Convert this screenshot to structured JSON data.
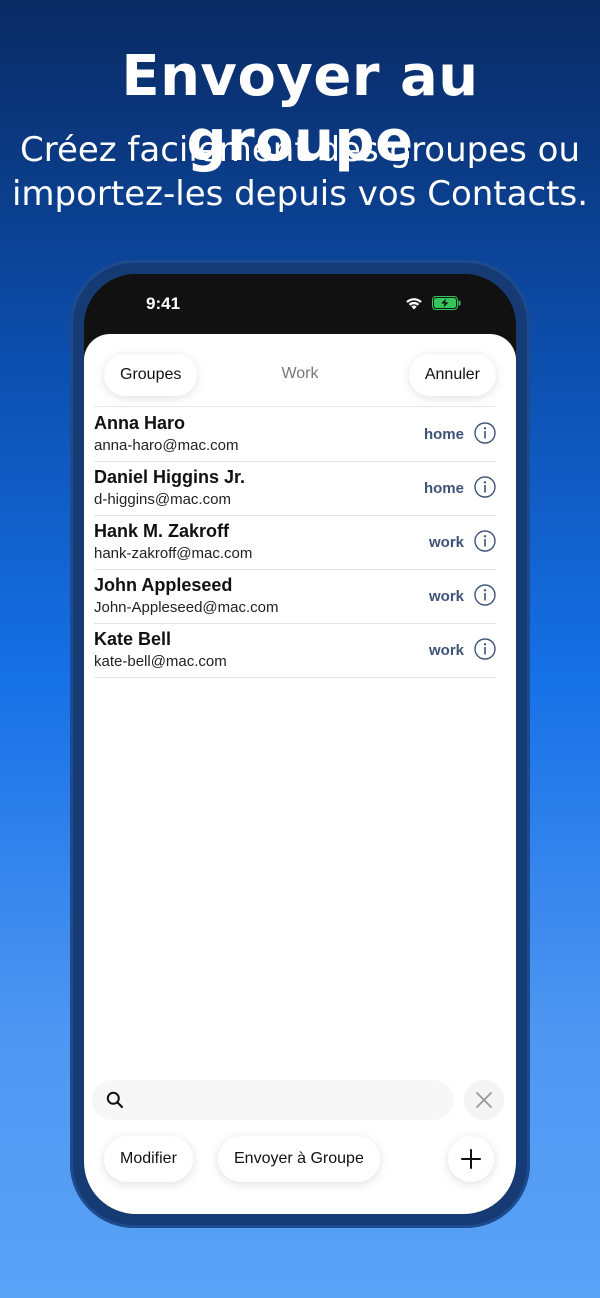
{
  "promo": {
    "headline": "Envoyer au groupe",
    "subline_1": "Créez facilement des groupes ou",
    "subline_2": "importez-les depuis vos Contacts."
  },
  "status_bar": {
    "time": "9:41"
  },
  "nav": {
    "groups_label": "Groupes",
    "title": "Work",
    "cancel_label": "Annuler"
  },
  "contacts": [
    {
      "name": "Anna Haro",
      "email": "anna-haro@mac.com",
      "label": "home"
    },
    {
      "name": "Daniel Higgins Jr.",
      "email": "d-higgins@mac.com",
      "label": "home"
    },
    {
      "name": "Hank M. Zakroff",
      "email": "hank-zakroff@mac.com",
      "label": "work"
    },
    {
      "name": "John Appleseed",
      "email": "John-Appleseed@mac.com",
      "label": "work"
    },
    {
      "name": "Kate Bell",
      "email": "kate-bell@mac.com",
      "label": "work"
    }
  ],
  "search": {
    "placeholder": ""
  },
  "toolbar": {
    "edit_label": "Modifier",
    "send_label": "Envoyer à Groupe"
  },
  "icons": [
    "wifi-icon",
    "battery-charging-icon",
    "info-icon",
    "search-icon",
    "close-icon",
    "plus-icon"
  ],
  "colors": {
    "accent_label": "#3e5378",
    "battery": "#34c759"
  }
}
